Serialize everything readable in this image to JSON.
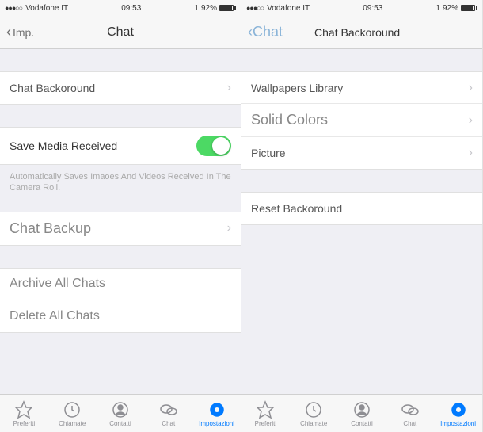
{
  "status": {
    "signal": "●●●○○",
    "carrier": "Vodafone IT",
    "time": "09:53",
    "battery_text": "92%",
    "battery_prefix": "1"
  },
  "left": {
    "nav": {
      "back": "Imp.",
      "title": "Chat"
    },
    "rows": {
      "chat_background": "Chat Backoround",
      "save_media": "Save Media Received",
      "save_media_desc": "Automatically Saves Imaoes And Videos Received In The Camera Roll.",
      "chat_backup": "Chat Backup",
      "archive_all": "Archive All Chats",
      "delete_all": "Delete All Chats"
    }
  },
  "right": {
    "nav": {
      "back": "Chat",
      "title": "Chat Backoround"
    },
    "rows": {
      "wallpapers": "Wallpapers Library",
      "solid_colors": "Solid Colors",
      "picture": "Picture",
      "reset": "Reset Backoround"
    }
  },
  "tabs": {
    "favorites": "Preferiti",
    "calls": "Chiamate",
    "contacts": "Contatti",
    "chat": "Chat",
    "settings": "Impostazioni"
  }
}
